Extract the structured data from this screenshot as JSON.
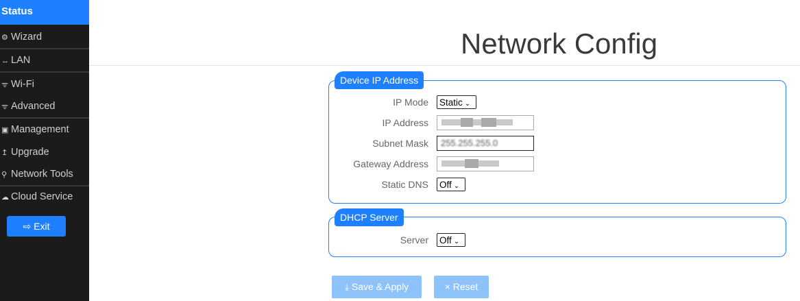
{
  "sidebar": {
    "status_label": "Status",
    "items": [
      {
        "icon": "gear-icon",
        "glyph": "⚙",
        "label": "Wizard"
      },
      {
        "icon": "arrows-icon",
        "glyph": "↔",
        "label": "LAN"
      },
      {
        "icon": "wifi-icon",
        "glyph": "ᯤ",
        "label": "Wi-Fi"
      },
      {
        "icon": "wifi-icon",
        "glyph": "ᯤ",
        "label": "Advanced"
      },
      {
        "icon": "management-icon",
        "glyph": "▣",
        "label": "Management"
      },
      {
        "icon": "upgrade-icon",
        "glyph": "↥",
        "label": "Upgrade"
      },
      {
        "icon": "search-icon",
        "glyph": "⚲",
        "label": "Network Tools"
      },
      {
        "icon": "cloud-icon",
        "glyph": "☁",
        "label": "Cloud Service"
      }
    ],
    "exit_label": "Exit",
    "exit_icon": "⇨"
  },
  "page": {
    "title": "Network Config"
  },
  "device_ip": {
    "legend": "Device IP Address",
    "ip_mode_label": "IP Mode",
    "ip_mode_value": "Static",
    "ip_address_label": "IP Address",
    "subnet_mask_label": "Subnet Mask",
    "subnet_mask_value": "255.255.255.0",
    "gateway_label": "Gateway Address",
    "static_dns_label": "Static DNS",
    "static_dns_value": "Off"
  },
  "dhcp": {
    "legend": "DHCP Server",
    "server_label": "Server",
    "server_value": "Off"
  },
  "actions": {
    "save_label": "Save & Apply",
    "save_icon": "⤓",
    "reset_label": "Reset",
    "reset_icon": "×"
  },
  "colors": {
    "accent": "#1e80ff",
    "sidebar_bg": "#1b1b1b",
    "button_disabled": "#8ec2fb"
  }
}
